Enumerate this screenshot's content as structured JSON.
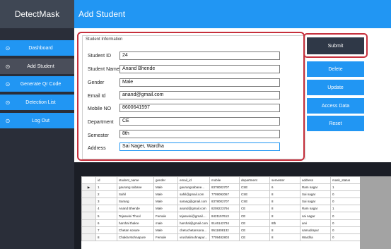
{
  "app": {
    "brand": "DetectMask",
    "page_title": "Add Student"
  },
  "sidebar": {
    "items": [
      {
        "label": "Dashboard",
        "icon": "check-circle-icon"
      },
      {
        "label": "Add Student",
        "icon": "check-circle-icon",
        "active": true
      },
      {
        "label": "Generate Qr Code",
        "icon": "check-circle-icon"
      },
      {
        "label": "Detection List",
        "icon": "check-circle-icon"
      },
      {
        "label": "Log Out",
        "icon": "check-circle-icon"
      }
    ]
  },
  "form": {
    "group_title": "Student Information",
    "fields": [
      {
        "label": "Student ID",
        "value": "24"
      },
      {
        "label": "Student Name",
        "value": "Anand Bhende"
      },
      {
        "label": "Gender",
        "value": "Male"
      },
      {
        "label": "Email Id",
        "value": "anand@gmail.com"
      },
      {
        "label": "Mobile NO",
        "value": "8600641597"
      },
      {
        "label": "Department",
        "value": "CE"
      },
      {
        "label": "Semester",
        "value": "8th"
      },
      {
        "label": "Address",
        "value": "Sai Nager, Wardha"
      }
    ]
  },
  "actions": {
    "submit": "Submit",
    "delete": "Delete",
    "update": "Update",
    "access_data": "Access Data",
    "reset": "Reset"
  },
  "grid": {
    "columns": [
      "id",
      "student_name",
      "gender",
      "email_id",
      "mobile",
      "department",
      "semester",
      "address",
      "mask_status"
    ],
    "rows": [
      [
        "1",
        "gaurang sabane",
        "Male",
        "gaurangsabane...",
        "8378002707",
        "CSE",
        "6",
        "Ram nagar",
        "1"
      ],
      [
        "2",
        "Sahil",
        "Male",
        "sahil@gmail.com",
        "7709092067",
        "CSE",
        "8",
        "Sai nagar",
        "0"
      ],
      [
        "3",
        "Sarang",
        "Male",
        "sarang@gmail.com",
        "8378002707",
        "CSE",
        "8",
        "Sai nagar",
        "0"
      ],
      [
        "4",
        "Anand Bhende",
        "Male",
        "anand@gmail.com",
        "8208223794",
        "CE",
        "8",
        "Ram nagar",
        "1"
      ],
      [
        "5",
        "Tejaswini Thool",
        "Female",
        "tejaswini@gmail....",
        "8421157613",
        "CE",
        "8",
        "sai nagar",
        "0"
      ],
      [
        "6",
        "harshal thakre",
        "male",
        "harshal@gmail.com",
        "9146142734",
        "CE",
        "8th",
        "arvi",
        "0"
      ],
      [
        "7",
        "Chetan sonare",
        "Male",
        "chetuchetansona...",
        "9511808132",
        "CE",
        "8",
        "samudrapur",
        "0"
      ],
      [
        "8",
        "Chakla Mohnapure",
        "Female",
        "vrushalimohnapur...",
        "7709482803",
        "CE",
        "8",
        "Wardha",
        "0"
      ]
    ],
    "current_row_marker": "▶"
  },
  "colors": {
    "accent": "#2196f3",
    "sidebar_bg": "#2a2e39",
    "highlight": "#c62f3c",
    "submit_bg": "#2f3847"
  }
}
